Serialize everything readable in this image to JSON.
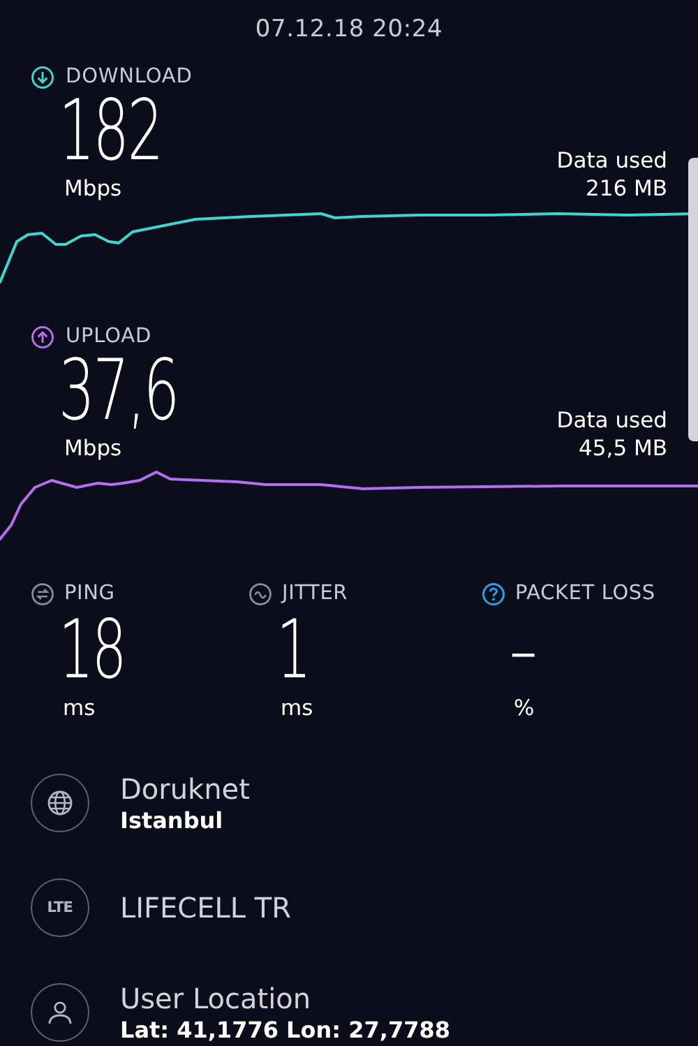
{
  "timestamp": "07.12.18 20:24",
  "results": [
    {
      "kind": "download",
      "label": "DOWNLOAD",
      "value": "182",
      "unit": "Mbps",
      "data_used_label": "Data used",
      "data_used": "216 MB"
    },
    {
      "kind": "upload",
      "label": "UPLOAD",
      "value": "37,6",
      "unit": "Mbps",
      "data_used_label": "Data used",
      "data_used": "45,5 MB"
    }
  ],
  "metrics": [
    {
      "kind": "ping",
      "label": "PING",
      "value": "18",
      "unit": "ms"
    },
    {
      "kind": "jitter",
      "label": "JITTER",
      "value": "1",
      "unit": "ms"
    },
    {
      "kind": "packet_loss",
      "label": "PACKET LOSS",
      "value": "–",
      "unit": "%"
    }
  ],
  "info": [
    {
      "kind": "server",
      "title": "Doruknet",
      "subtitle": "Istanbul"
    },
    {
      "kind": "connection",
      "badge": "LTE",
      "title": "LIFECELL TR"
    },
    {
      "kind": "location",
      "title": "User Location",
      "subtitle": "Lat: 41,1776 Lon: 27,7788"
    }
  ]
}
